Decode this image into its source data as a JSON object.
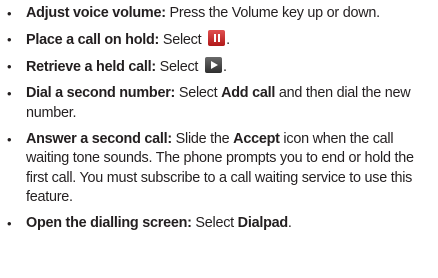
{
  "bullet_glyph": "•",
  "items": [
    {
      "lead": "Adjust voice volume:",
      "text": " Press the Volume key up or down."
    },
    {
      "lead": "Place a call on hold:",
      "text_before_icon": " Select ",
      "icon": "hold-icon",
      "text_after_icon": "."
    },
    {
      "lead": "Retrieve a held call:",
      "text_before_icon": " Select ",
      "icon": "play-icon",
      "text_after_icon": "."
    },
    {
      "lead": "Dial a second number:",
      "text_1": " Select ",
      "bold_1": "Add call",
      "text_2": " and then dial the new number."
    },
    {
      "lead": "Answer a second call:",
      "text_1": " Slide the ",
      "bold_1": "Accept",
      "text_2": " icon when the call waiting tone sounds. The phone prompts you to end or hold the first call. You must subscribe to a call waiting service to use this feature."
    },
    {
      "lead": "Open the dialling screen:",
      "text_1": " Select ",
      "bold_1": "Dialpad",
      "text_2": "."
    }
  ]
}
